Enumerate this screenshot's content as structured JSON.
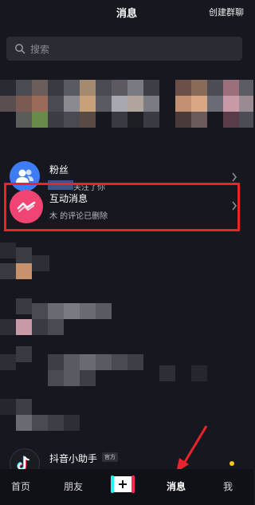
{
  "header": {
    "title": "消息",
    "action": "创建群聊"
  },
  "search": {
    "placeholder": "搜索",
    "icon": "search-icon"
  },
  "rows": {
    "fans": {
      "name": "粉丝",
      "sub": "关注了你",
      "icon": "users-icon",
      "color": "#3d7cf4"
    },
    "interaction": {
      "name": "互动消息",
      "sub": "木 的评论已删除",
      "icon": "wave-icon",
      "color": "#f04572"
    },
    "assistant": {
      "name": "抖音小助手",
      "badge": "官方",
      "icon": "tiktok-icon"
    }
  },
  "tabs": [
    {
      "label": "首页"
    },
    {
      "label": "朋友"
    },
    {
      "label": "消息",
      "active": true
    },
    {
      "label": "我"
    }
  ],
  "colors": {
    "highlight": "#e8242c",
    "annotation_arrow": "#e8242c",
    "background": "#16171f"
  }
}
